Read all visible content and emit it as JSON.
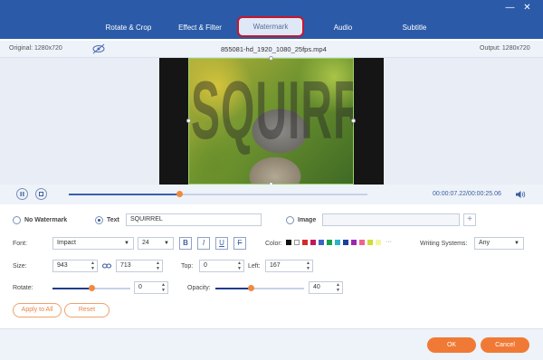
{
  "tabs": [
    {
      "label": "Rotate & Crop"
    },
    {
      "label": "Effect & Filter"
    },
    {
      "label": "Watermark"
    },
    {
      "label": "Audio"
    },
    {
      "label": "Subtitle"
    }
  ],
  "info": {
    "original": "Original: 1280x720",
    "filename": "855081-hd_1920_1080_25fps.mp4",
    "output": "Output: 1280x720"
  },
  "preview": {
    "watermark_text": "SQUIRREL"
  },
  "player": {
    "time": "00:00:07.22/00:00:25.06",
    "progress": 0.37
  },
  "watermark": {
    "no_watermark_label": "No Watermark",
    "text_label": "Text",
    "text_value": "SQUIRREL",
    "image_label": "Image",
    "image_value": "",
    "add_symbol": "+",
    "selected": "text"
  },
  "font": {
    "label": "Font:",
    "family": "Impact",
    "size": "24",
    "bold": "B",
    "italic": "I",
    "underline": "U",
    "strike": "F",
    "color_label": "Color:",
    "colors": [
      "#111111",
      "#ffffff",
      "#d42a2a",
      "#c2185b",
      "#3b64c8",
      "#1aa34a",
      "#2fb3c9",
      "#1c3f9a",
      "#9c27b0",
      "#f06292",
      "#cddc39",
      "#f5f5a0"
    ],
    "more": "···",
    "writing_label": "Writing Systems:",
    "writing_value": "Any"
  },
  "size": {
    "label": "Size:",
    "width": "943",
    "height": "713",
    "top_label": "Top:",
    "top_value": "0",
    "left_label": "Left:",
    "left_value": "167"
  },
  "rotate": {
    "label": "Rotate:",
    "value": "0",
    "level": 0.5
  },
  "opacity": {
    "label": "Opacity:",
    "value": "40",
    "level": 0.4
  },
  "buttons": {
    "apply_all": "Apply to All",
    "reset": "Reset",
    "ok": "OK",
    "cancel": "Cancel"
  },
  "window": {
    "minimize": "—",
    "close": "✕"
  }
}
